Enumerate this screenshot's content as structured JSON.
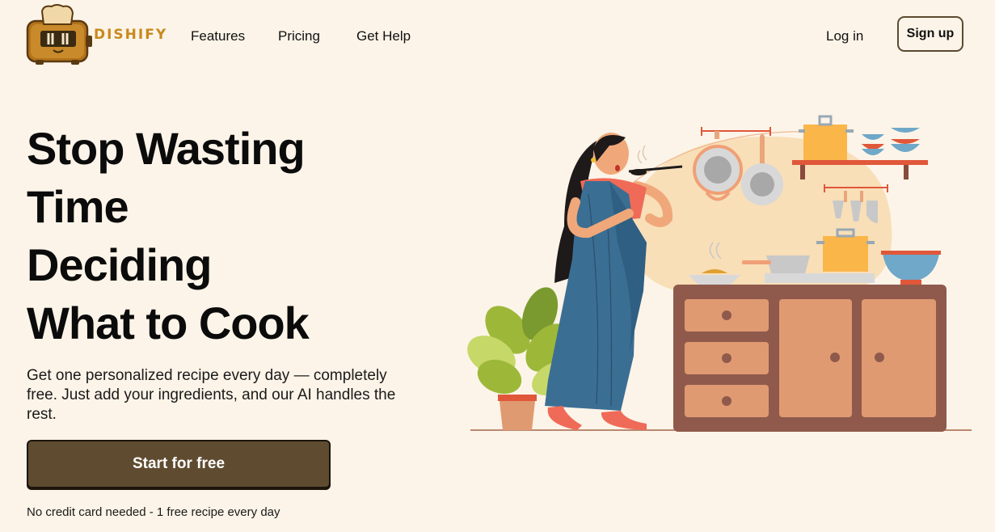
{
  "header": {
    "brand": "DISHIFY",
    "nav": [
      "Features",
      "Pricing",
      "Get Help"
    ],
    "login_label": "Log in",
    "signup_label": "Sign up"
  },
  "hero": {
    "title_lines": [
      "Stop Wasting",
      "Time",
      "Deciding",
      "What to Cook"
    ],
    "subtitle": "Get one personalized recipe every day — completely free. Just add your ingredients, and our AI handles the rest.",
    "cta_label": "Start for free",
    "note": "No credit card needed - 1 free recipe every day"
  },
  "colors": {
    "background": "#fcf4e8",
    "brand": "#c8891e",
    "cta": "#5f4b30",
    "cabinet": "#8f5a4c",
    "saree": "#3b6e93"
  },
  "icons": {
    "logo": "toaster-mascot-icon",
    "illustration": "woman-cooking-kitchen-illustration"
  }
}
